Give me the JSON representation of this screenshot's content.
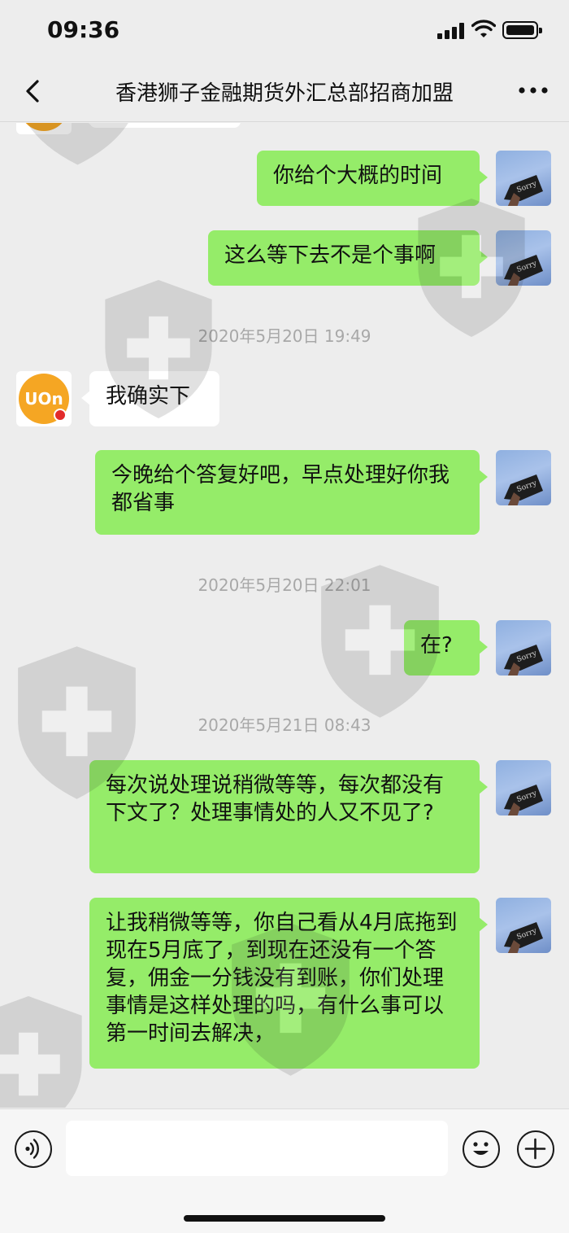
{
  "status_bar": {
    "time": "09:36"
  },
  "nav": {
    "title": "香港狮子金融期货外汇总部招商加盟"
  },
  "avatar_other_text": "UOn",
  "messages": [
    {
      "side": "me",
      "text": "你给个大概的时间"
    },
    {
      "side": "me",
      "text": "这么等下去不是个事啊"
    },
    {
      "timestamp": "2020年5月20日 19:49"
    },
    {
      "side": "other",
      "text": "我确实下"
    },
    {
      "side": "me",
      "text": "今晚给个答复好吧，早点处理好你我都省事"
    },
    {
      "timestamp": "2020年5月20日 22:01"
    },
    {
      "side": "me",
      "text": "在?"
    },
    {
      "timestamp": "2020年5月21日 08:43"
    },
    {
      "side": "me",
      "text": "每次说处理说稍微等等，每次都没有下文了？处理事情处的人又不见了?"
    },
    {
      "side": "me",
      "text": "让我稍微等等，你自己看从4月底拖到现在5月底了，到现在还没有一个答复，佣金一分钱没有到账，你们处理事情是这样处理的吗，有什么事可以第一时间去解决，"
    }
  ],
  "input": {
    "value": ""
  },
  "icons": {
    "back": "chevron-left-icon",
    "more": "more-dots-icon",
    "voice": "voice-icon",
    "emoji": "emoji-icon",
    "plus": "plus-icon"
  },
  "colors": {
    "my_bubble": "#95ec69",
    "other_bubble": "#ffffff",
    "background": "#ededed",
    "other_avatar_accent": "#f5a623"
  }
}
